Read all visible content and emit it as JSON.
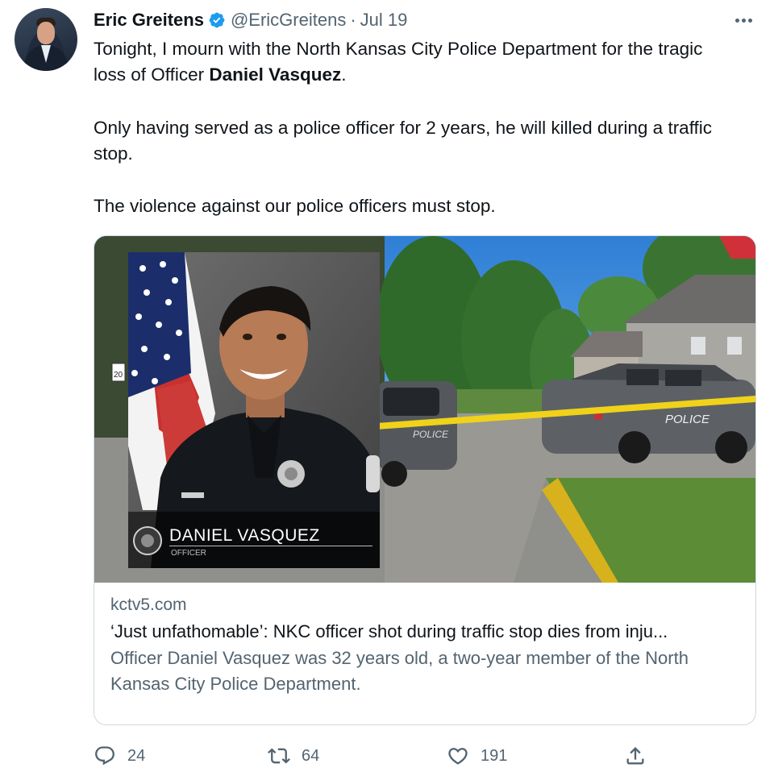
{
  "tweet": {
    "author_name": "Eric Greitens",
    "author_handle": "@EricGreitens",
    "separator": "·",
    "date": "Jul 19",
    "p1_prefix": "Tonight, I mourn with the North Kansas City Police Department for the tragic loss of Officer ",
    "p1_bold": "Daniel Vasquez",
    "p1_suffix": ".",
    "p2": "Only having served as a police officer for 2 years, he will killed during a traffic stop.",
    "p3": "The violence against our police officers must stop."
  },
  "card": {
    "image": {
      "officer_name": "DANIEL VASQUEZ",
      "officer_title": "OFFICER",
      "car_text": "POLICE",
      "sign_number": "20"
    },
    "domain": "kctv5.com",
    "headline": "‘Just unfathomable’: NKC officer shot during traffic stop dies from inju...",
    "description": "Officer Daniel Vasquez was 32 years old, a two-year member of the North Kansas City Police Department."
  },
  "actions": {
    "reply_count": "24",
    "retweet_count": "64",
    "like_count": "191"
  },
  "icons": [
    "verified-badge-icon",
    "more-icon",
    "reply-icon",
    "retweet-icon",
    "like-icon",
    "share-icon"
  ],
  "colors": {
    "secondary_text": "#536471",
    "verified_blue": "#1d9bf0",
    "border": "#cfd9de"
  }
}
